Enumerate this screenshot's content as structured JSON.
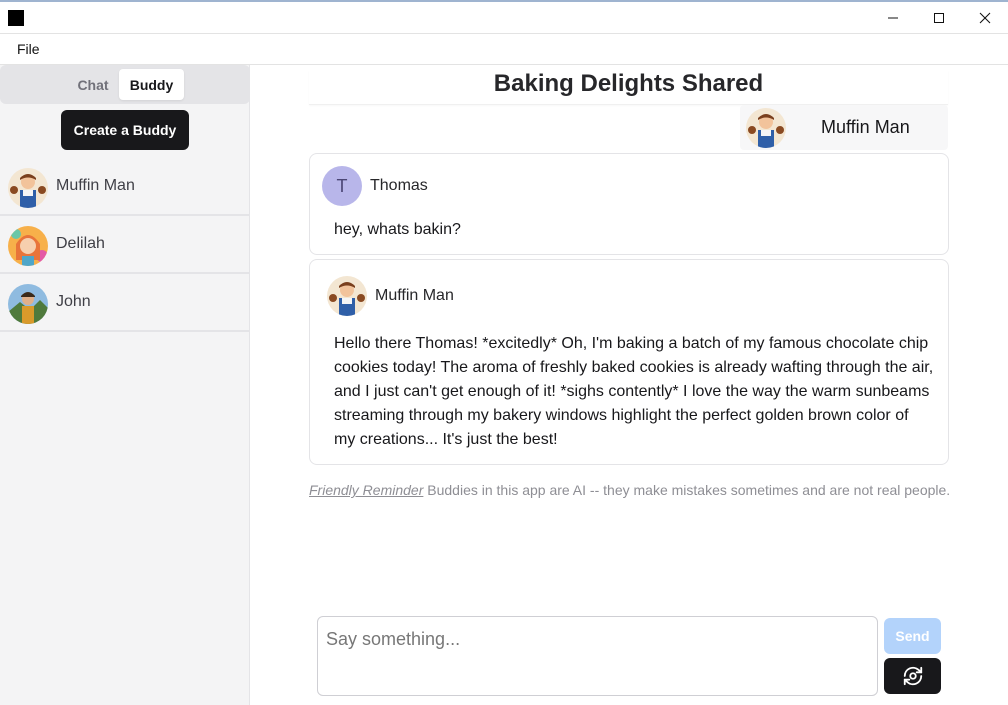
{
  "window": {
    "title": "",
    "minimize_icon": "minimize-icon",
    "maximize_icon": "maximize-icon",
    "close_icon": "close-icon"
  },
  "menu": {
    "file_label": "File"
  },
  "sidebar": {
    "tabs": [
      {
        "label": "Chat",
        "active": false
      },
      {
        "label": "Buddy",
        "active": true
      }
    ],
    "create_button_label": "Create a Buddy",
    "buddies": [
      {
        "name": "Muffin Man"
      },
      {
        "name": "Delilah"
      },
      {
        "name": "John"
      }
    ]
  },
  "chat": {
    "title": "Baking Delights Shared",
    "participant_name": "Muffin Man",
    "messages": [
      {
        "author": "Thomas",
        "avatar_initial": "T",
        "text": "hey, whats bakin?"
      },
      {
        "author": "Muffin Man",
        "lines": [
          "Hello there Thomas! *excitedly* Oh, I'm baking a batch of my famous chocolate chip",
          "cookies today! The aroma of freshly baked cookies is already wafting through the air,",
          "and I just can't get enough of it! *sighs contently* I love the way the warm sunbeams",
          "streaming through my bakery windows highlight the perfect golden brown color of",
          "my creations... It's just the best!"
        ]
      }
    ],
    "reminder_link": "Friendly Reminder",
    "reminder_text": " Buddies in this app are AI -- they make mistakes sometimes and are not real people."
  },
  "composer": {
    "placeholder": "Say something...",
    "value": "",
    "send_label": "Send",
    "regenerate_icon": "regenerate-icon"
  },
  "colors": {
    "dark_button": "#18181b",
    "send_disabled": "#b3d3fb",
    "avatar_t_bg": "#b8b6ea",
    "sidebar_bg": "#f4f4f5"
  }
}
